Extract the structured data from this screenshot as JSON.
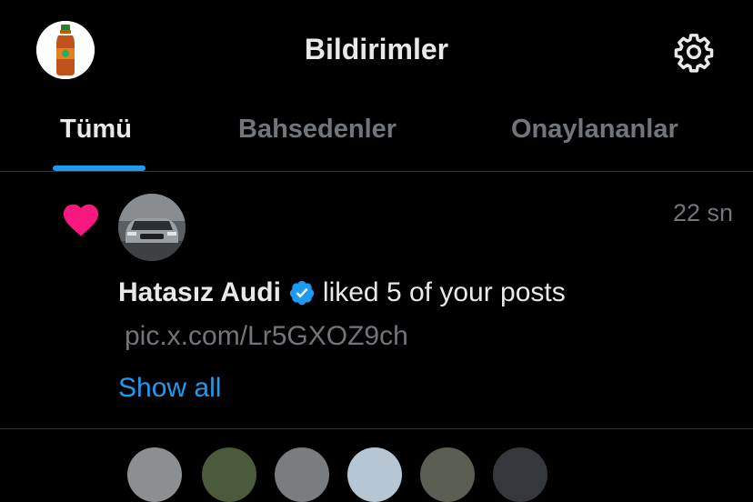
{
  "header": {
    "title": "Bildirimler",
    "profile_icon": "profile-avatar-icon",
    "settings_icon": "gear-icon"
  },
  "tabs": [
    {
      "label": "Tümü",
      "active": true
    },
    {
      "label": "Bahsedenler",
      "active": false
    },
    {
      "label": "Onaylananlar",
      "active": false
    }
  ],
  "notification": {
    "icon": "heart-icon",
    "actor_name": "Hatasız Audi",
    "action_text": "liked 5 of your posts",
    "link": "pic.x.com/Lr5GXOZ9ch",
    "time": "22 sn",
    "show_all": "Show all"
  },
  "colors": {
    "accent": "#1d9bf0",
    "like": "#f91880",
    "muted": "#71767b",
    "background": "#000000"
  }
}
